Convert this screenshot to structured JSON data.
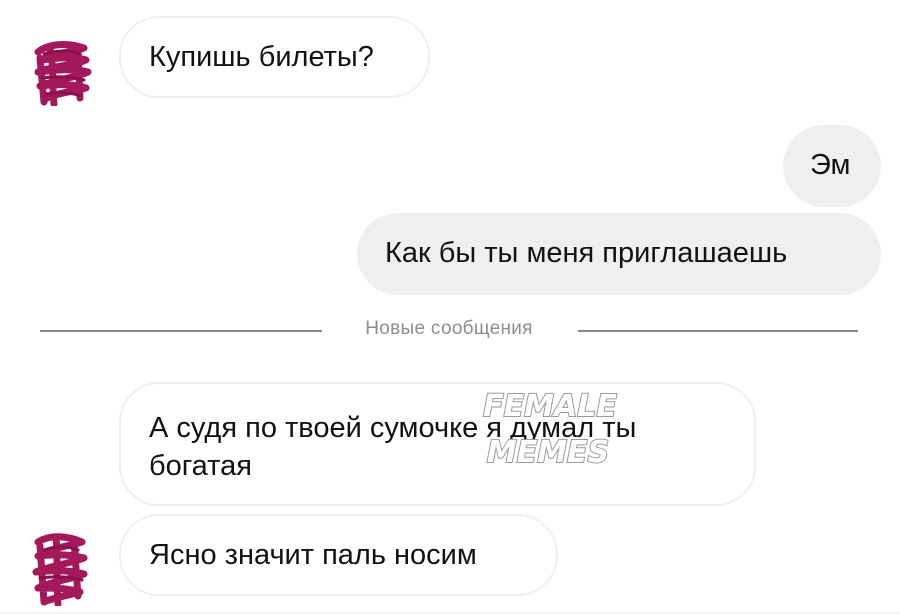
{
  "conversation": {
    "messages": [
      {
        "direction": "incoming",
        "text": "Купишь билеты?"
      },
      {
        "direction": "outgoing",
        "text": "Эм"
      },
      {
        "direction": "outgoing",
        "text": "Как бы ты меня приглашаешь"
      },
      {
        "direction": "incoming",
        "lines": [
          "А судя по твоей сумочке я думал ты",
          "богатая"
        ]
      },
      {
        "direction": "incoming",
        "text": "Ясно значит паль носим"
      }
    ],
    "new_messages_divider": "Новые сообщения"
  },
  "watermark": {
    "line1": "FEMALE",
    "line2": "MEMES"
  },
  "colors": {
    "outgoing_bubble": "#efefef",
    "incoming_border": "#efefef",
    "avatar_scribble": "#a3195b",
    "divider_text": "#8e8e8e",
    "divider_line": "#8a8a8a"
  },
  "icons": {
    "avatar": "avatar-scribbled-out"
  }
}
